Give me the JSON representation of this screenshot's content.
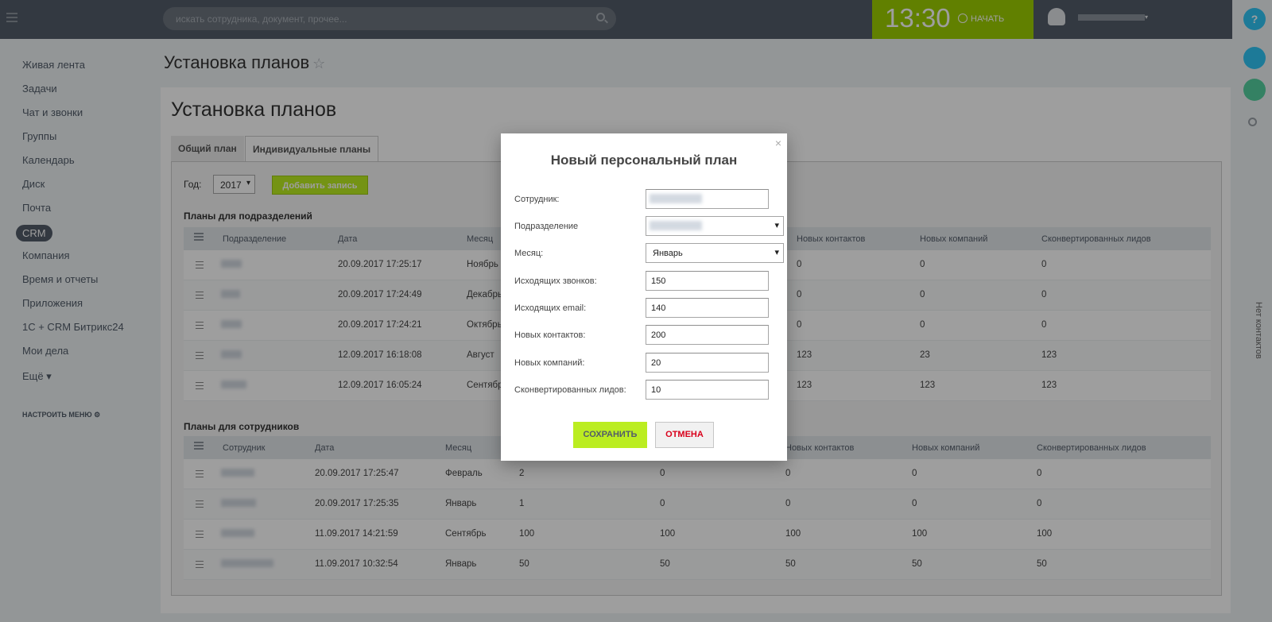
{
  "search": {
    "placeholder": "искать сотрудника, документ, прочее..."
  },
  "clock": {
    "time": "13:30",
    "start_label": "НАЧАТЬ"
  },
  "help": {
    "label": "?"
  },
  "right_panel": {
    "vertical_label": "Нет контактов"
  },
  "leftmenu": {
    "items": [
      "Живая лента",
      "Задачи",
      "Чат и звонки",
      "Группы",
      "Календарь",
      "Диск",
      "Почта",
      "CRM",
      "Компания",
      "Время и отчеты",
      "Приложения",
      "1С + CRM Битрикс24",
      "Мои дела",
      "Ещё"
    ],
    "configure": "НАСТРОИТЬ МЕНЮ"
  },
  "page": {
    "title": "Установка планов",
    "heading": "Установка планов"
  },
  "tabs": [
    "Общий план",
    "Индивидуальные планы"
  ],
  "filter": {
    "year_label": "Год:",
    "year": "2017",
    "add_button": "Добавить запись"
  },
  "dept_section": {
    "title": "Планы для подразделений",
    "headers": [
      "Подразделение",
      "Дата",
      "Месяц",
      "Новых контактов",
      "Новых компаний",
      "Сконвертированных лидов"
    ],
    "rows": [
      {
        "date": "20.09.2017 17:25:17",
        "month": "Ноябрь",
        "contacts": "0",
        "companies": "0",
        "leads": "0"
      },
      {
        "date": "20.09.2017 17:24:49",
        "month": "Декабрь",
        "contacts": "0",
        "companies": "0",
        "leads": "0"
      },
      {
        "date": "20.09.2017 17:24:21",
        "month": "Октябрь",
        "contacts": "0",
        "companies": "0",
        "leads": "0"
      },
      {
        "date": "12.09.2017 16:18:08",
        "month": "Август",
        "contacts": "123",
        "companies": "23",
        "leads": "123"
      },
      {
        "date": "12.09.2017 16:05:24",
        "month": "Сентябрь",
        "contacts": "123",
        "companies": "123",
        "leads": "123"
      }
    ]
  },
  "emp_section": {
    "title": "Планы для сотрудников",
    "headers": [
      "Сотрудник",
      "Дата",
      "Месяц",
      "Новых контактов",
      "Новых компаний",
      "Сконвертированных лидов"
    ],
    "rows": [
      {
        "date": "20.09.2017 17:25:47",
        "month": "Февраль",
        "c1": "2",
        "c2": "0",
        "contacts": "0",
        "companies": "0",
        "leads": "0"
      },
      {
        "date": "20.09.2017 17:25:35",
        "month": "Январь",
        "c1": "1",
        "c2": "0",
        "contacts": "0",
        "companies": "0",
        "leads": "0"
      },
      {
        "date": "11.09.2017 14:21:59",
        "month": "Сентябрь",
        "c1": "100",
        "c2": "100",
        "contacts": "100",
        "companies": "100",
        "leads": "100"
      },
      {
        "date": "11.09.2017 10:32:54",
        "month": "Январь",
        "c1": "50",
        "c2": "50",
        "contacts": "50",
        "companies": "50",
        "leads": "50"
      }
    ]
  },
  "modal": {
    "title": "Новый персональный план",
    "fields": {
      "employee_label": "Сотрудник:",
      "dept_label": "Подразделение",
      "month_label": "Месяц:",
      "month_value": "Январь",
      "calls_label": "Исходящих звонков:",
      "calls_value": "150",
      "email_label": "Исходящих email:",
      "email_value": "140",
      "contacts_label": "Новых контактов:",
      "contacts_value": "200",
      "companies_label": "Новых компаний:",
      "companies_value": "20",
      "leads_label": "Сконвертированных лидов:",
      "leads_value": "10"
    },
    "save": "СОХРАНИТЬ",
    "cancel": "ОТМЕНА",
    "close": "×"
  }
}
